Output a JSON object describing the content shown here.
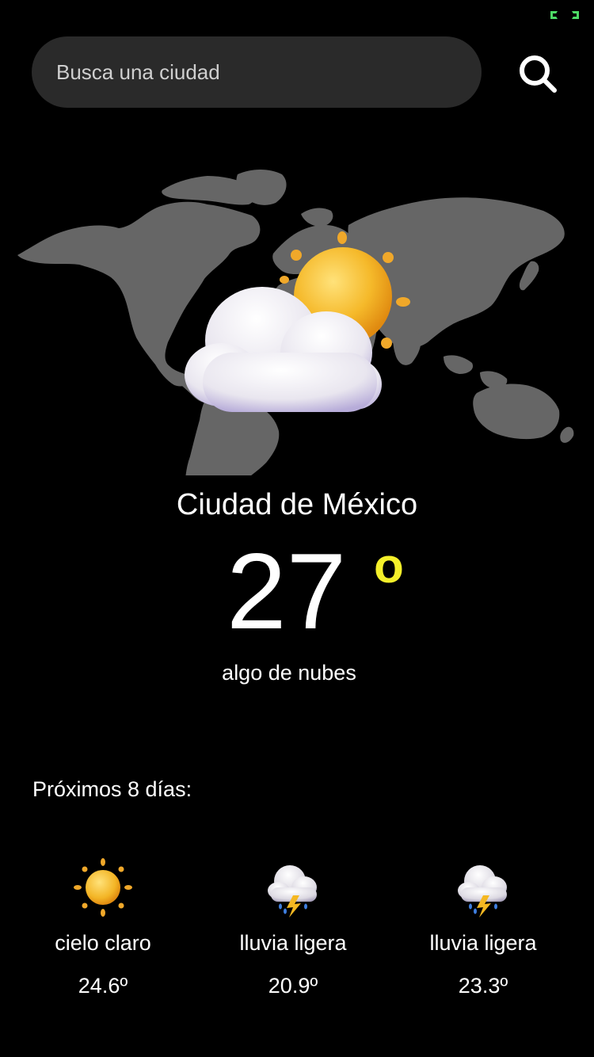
{
  "search": {
    "placeholder": "Busca una ciudad"
  },
  "current": {
    "city": "Ciudad de México",
    "temperature": "27",
    "unit": "o",
    "condition": "algo de nubes",
    "icon": "partly-cloudy-icon"
  },
  "forecast": {
    "title": "Próximos 8 días:",
    "days": [
      {
        "description": "cielo claro",
        "temperature": "24.6º",
        "icon": "sun-icon"
      },
      {
        "description": "lluvia ligera",
        "temperature": "20.9º",
        "icon": "thunderstorm-icon"
      },
      {
        "description": "lluvia ligera",
        "temperature": "23.3º",
        "icon": "thunderstorm-icon"
      }
    ]
  },
  "colors": {
    "background": "#000000",
    "search_bg": "#2a2a2a",
    "accent": "#f4ef2a",
    "map": "#666666",
    "status_indicator": "#4cd964"
  }
}
